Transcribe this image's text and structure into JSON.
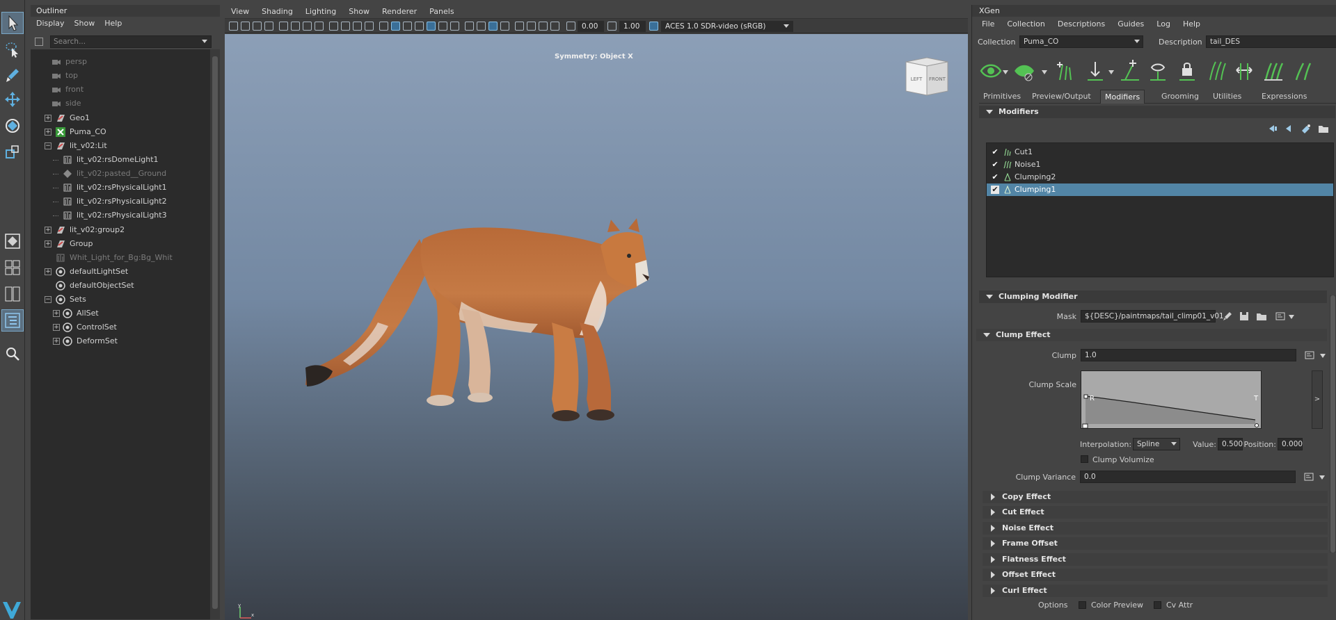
{
  "toolbox": {
    "tools": [
      "select-tool",
      "lasso-tool",
      "paint-select-tool",
      "move-tool",
      "rotate-tool",
      "scale-tool",
      "quick-layout-single",
      "quick-layout-four",
      "quick-layout-two",
      "outliner-layout",
      "search-icon"
    ]
  },
  "outliner": {
    "title": "Outliner",
    "menu": [
      "Display",
      "Show",
      "Help"
    ],
    "search_placeholder": "Search...",
    "nodes": [
      {
        "label": "persp",
        "type": "camera",
        "dim": true
      },
      {
        "label": "top",
        "type": "camera",
        "dim": true
      },
      {
        "label": "front",
        "type": "camera",
        "dim": true
      },
      {
        "label": "side",
        "type": "camera",
        "dim": true
      },
      {
        "label": "Geo1",
        "type": "group",
        "dim": false
      },
      {
        "label": "Puma_CO",
        "type": "xgen-collection",
        "dim": false
      },
      {
        "label": "lit_v02:Lit",
        "type": "group",
        "dim": false
      },
      {
        "label": "lit_v02:rsDomeLight1",
        "type": "light",
        "dim": false
      },
      {
        "label": "lit_v02:pasted__Ground",
        "type": "mesh",
        "dim": true
      },
      {
        "label": "lit_v02:rsPhysicalLight1",
        "type": "light",
        "dim": false
      },
      {
        "label": "lit_v02:rsPhysicalLight2",
        "type": "light",
        "dim": false
      },
      {
        "label": "lit_v02:rsPhysicalLight3",
        "type": "light",
        "dim": false
      },
      {
        "label": "lit_v02:group2",
        "type": "group",
        "dim": false
      },
      {
        "label": "Group",
        "type": "group",
        "dim": false
      },
      {
        "label": "Whit_Light_for_Bg:Bg_Whit",
        "type": "light",
        "dim": true
      },
      {
        "label": "defaultLightSet",
        "type": "set",
        "dim": false
      },
      {
        "label": "defaultObjectSet",
        "type": "set",
        "dim": false
      },
      {
        "label": "Sets",
        "type": "set",
        "dim": false
      },
      {
        "label": "AllSet",
        "type": "set",
        "dim": false
      },
      {
        "label": "ControlSet",
        "type": "set",
        "dim": false
      },
      {
        "label": "DeformSet",
        "type": "set",
        "dim": false
      }
    ]
  },
  "viewport": {
    "menu": [
      "View",
      "Shading",
      "Lighting",
      "Show",
      "Renderer",
      "Panels"
    ],
    "exposure": "0.00",
    "gamma": "1.00",
    "color_space": "ACES 1.0 SDR-video (sRGB)",
    "symmetry_text": "Symmetry: Object X",
    "viewcube_left": "LEFT",
    "viewcube_front": "FRONT",
    "axis_y": "y",
    "axis_x": "x"
  },
  "xgen": {
    "title": "XGen",
    "menu": [
      "File",
      "Collection",
      "Descriptions",
      "Guides",
      "Log",
      "Help"
    ],
    "collection_label": "Collection",
    "collection_value": "Puma_CO",
    "description_label": "Description",
    "description_value": "tail_DES",
    "tabs": [
      "Primitives",
      "Preview/Output",
      "Modifiers",
      "Grooming",
      "Utilities",
      "Expressions"
    ],
    "active_tab": "Modifiers",
    "modifiers_header": "Modifiers",
    "modifiers": [
      {
        "label": "Cut1",
        "selected": false
      },
      {
        "label": "Noise1",
        "selected": false
      },
      {
        "label": "Clumping2",
        "selected": false
      },
      {
        "label": "Clumping1",
        "selected": true
      }
    ],
    "clumping_header": "Clumping Modifier",
    "mask_label": "Mask",
    "mask_value": "${DESC}/paintmaps/tail_climp01_v01",
    "clump_effect_header": "Clump Effect",
    "clump_label": "Clump",
    "clump_value": "1.0",
    "clump_scale_label": "Clump Scale",
    "ramp_left_letter": "R",
    "ramp_right_letter": "T",
    "ramp_expand": ">",
    "interpolation_label": "Interpolation:",
    "interpolation_value": "Spline",
    "value_label": "Value:",
    "value_value": "0.500",
    "position_label": "Position:",
    "position_value": "0.000",
    "clump_volumize_label": "Clump Volumize",
    "clump_variance_label": "Clump Variance",
    "clump_variance_value": "0.0",
    "collapsed_sections": [
      "Copy Effect",
      "Cut Effect",
      "Noise Effect",
      "Frame Offset",
      "Flatness Effect",
      "Offset Effect",
      "Curl Effect"
    ],
    "options_label": "Options",
    "color_preview_label": "Color Preview",
    "cv_attr_label": "Cv Attr"
  },
  "colors": {
    "selection": "#5285a6",
    "panel_bg": "#444444",
    "field_bg": "#2b2b2b",
    "puma_fur": "#c06a36"
  }
}
